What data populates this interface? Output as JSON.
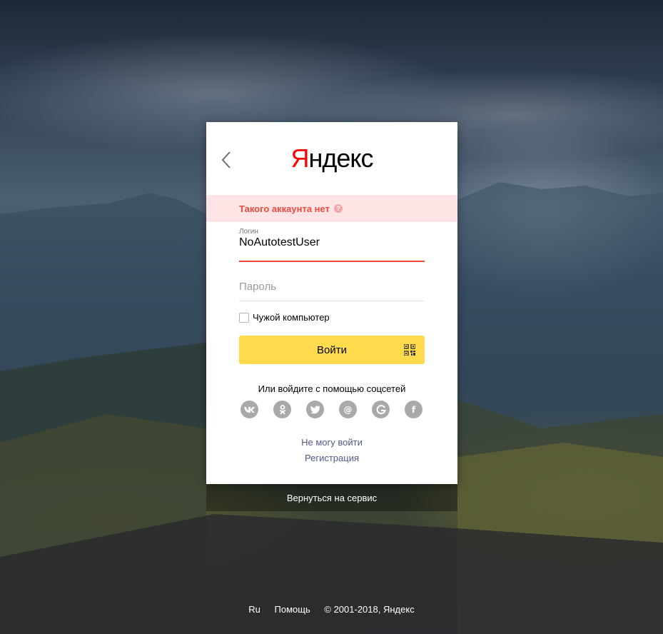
{
  "logo": {
    "first_letter": "Я",
    "rest": "ндекс"
  },
  "error": {
    "message": "Такого аккаунта нет"
  },
  "login": {
    "label": "Логин",
    "value": "NoAutotestUser"
  },
  "password": {
    "placeholder": "Пароль"
  },
  "checkbox": {
    "label": "Чужой компьютер",
    "checked": false
  },
  "submit": {
    "label": "Войти"
  },
  "social": {
    "title": "Или войдите с помощью соцсетей",
    "providers": [
      "vk-icon",
      "odnoklassniki-icon",
      "twitter-icon",
      "mail-icon",
      "google-icon",
      "facebook-icon"
    ]
  },
  "links": {
    "cant_login": "Не могу войти",
    "register": "Регистрация"
  },
  "return_link": "Вернуться на сервис",
  "footer": {
    "lang": "Ru",
    "help": "Помощь",
    "copyright": "© 2001-2018, Яндекс"
  },
  "colors": {
    "accent_yellow": "#ffdb4d",
    "error_red": "#e84c3d",
    "error_bg": "#ffe4e6",
    "link_purple": "#54588a"
  }
}
